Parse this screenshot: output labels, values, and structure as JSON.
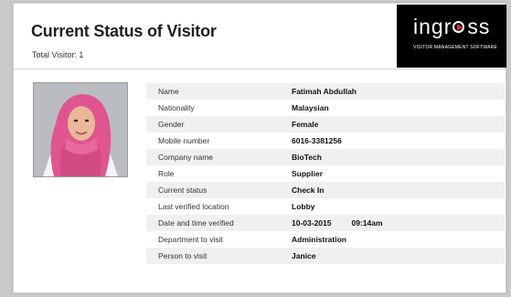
{
  "header": {
    "title": "Current Status of Visitor",
    "total_visitor": "Total Visitor: 1"
  },
  "logo": {
    "word_start": "ingr",
    "word_end": "ss",
    "tagline": "VISITOR MANAGEMENT SOFTWARE",
    "accent_color": "#e2262c"
  },
  "photo": {
    "icon": "visitor-photo"
  },
  "visitor": {
    "rows": [
      {
        "label": "Name",
        "value": "Fatimah Abdullah"
      },
      {
        "label": "Nationality",
        "value": "Malaysian"
      },
      {
        "label": "Gender",
        "value": "Female"
      },
      {
        "label": "Mobile number",
        "value": "6016-3381256"
      },
      {
        "label": "Company name",
        "value": "BioTech"
      },
      {
        "label": "Role",
        "value": "Supplier"
      },
      {
        "label": "Current status",
        "value": "Check In"
      },
      {
        "label": "Last verified location",
        "value": "Lobby"
      },
      {
        "label": "Date and time verified",
        "value": "10-03-2015",
        "time": "09:14am"
      },
      {
        "label": "Department to visit",
        "value": "Administration"
      },
      {
        "label": "Person to visit",
        "value": "Janice"
      }
    ]
  }
}
